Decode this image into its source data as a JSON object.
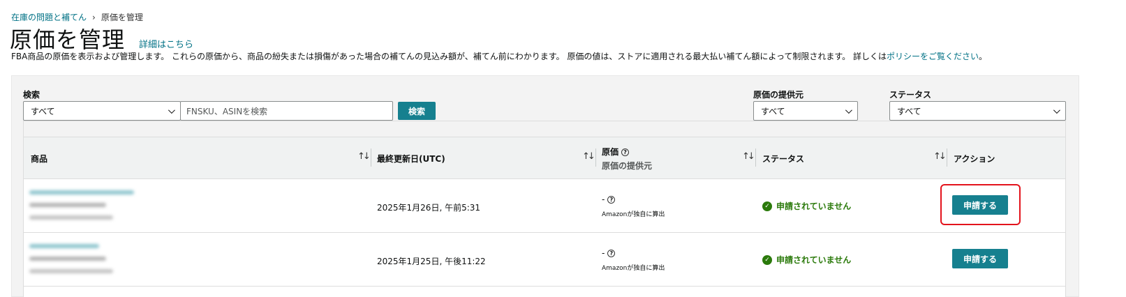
{
  "breadcrumb": {
    "parent": "在庫の問題と補てん",
    "separator": "›",
    "current": "原価を管理"
  },
  "header": {
    "title": "原価を管理",
    "details_link": "詳細はこちら"
  },
  "description": {
    "text": "FBA商品の原価を表示および管理します。 これらの原価から、商品の紛失または損傷があった場合の補てんの見込み額が、補てん前にわかります。 原価の値は、ストアに適用される最大払い補てん額によって制限されます。 詳しくは",
    "link": "ポリシーをご覧ください",
    "suffix": "。"
  },
  "search": {
    "label": "検索",
    "scope_value": "すべて",
    "placeholder": "FNSKU、ASINを検索",
    "button": "検索"
  },
  "filters": {
    "cost_source": {
      "label": "原価の提供元",
      "value": "すべて"
    },
    "status": {
      "label": "ステータス",
      "value": "すべて"
    }
  },
  "table": {
    "columns": {
      "product": "商品",
      "updated": "最終更新日(UTC)",
      "cost": "原価",
      "cost_source": "原価の提供元",
      "status": "ステータス",
      "action": "アクション"
    },
    "rows": [
      {
        "updated": "2025年1月26日, 午前5:31",
        "cost": "-",
        "cost_source": "Amazonが独自に算出",
        "status": "申請されていません",
        "action": "申請する"
      },
      {
        "updated": "2025年1月25日, 午後11:22",
        "cost": "-",
        "cost_source": "Amazonが独自に算出",
        "status": "申請されていません",
        "action": "申請する"
      }
    ]
  },
  "colors": {
    "accent": "#16808f",
    "link": "#007185",
    "success": "#2b7a0b",
    "highlight": "#e3131c"
  }
}
